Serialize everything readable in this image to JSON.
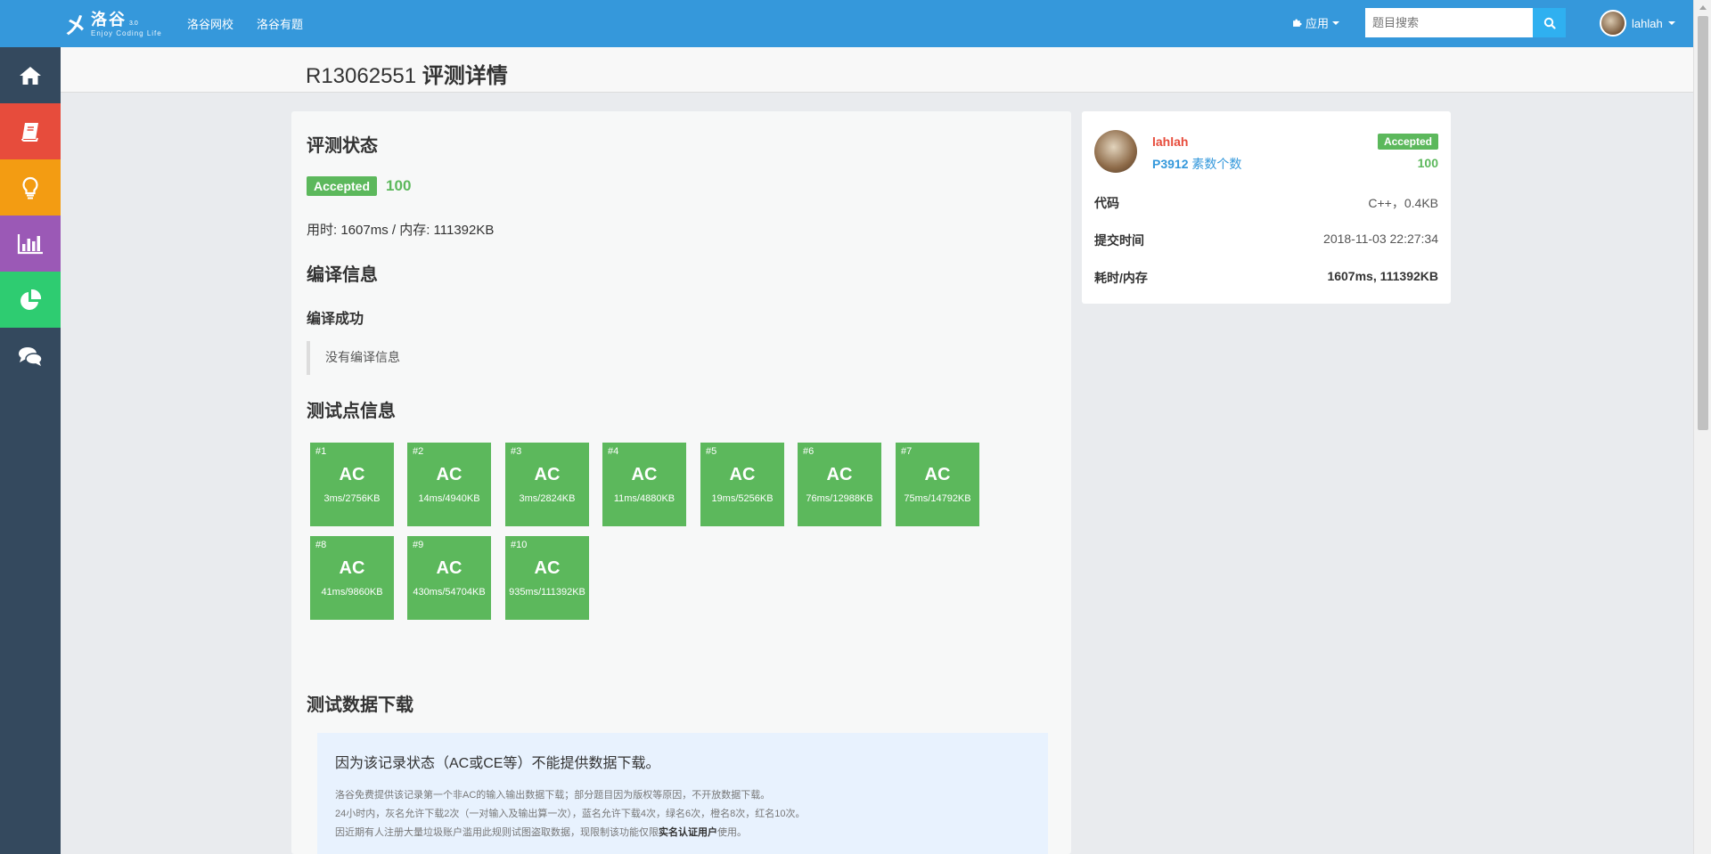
{
  "brand": {
    "logo_mark": "㐅",
    "logo_cn": "洛谷",
    "logo_version": "3.0",
    "logo_en": "Enjoy Coding Life"
  },
  "nav": {
    "links": [
      "洛谷网校",
      "洛谷有题"
    ],
    "apps_label": "应用",
    "search_placeholder": "题目搜索",
    "username": "lahlah"
  },
  "sidebar": {
    "items": [
      "home-icon",
      "book-icon",
      "bulb-icon",
      "chart-icon",
      "pie-icon",
      "chat-icon"
    ]
  },
  "page": {
    "record_id": "R13062551",
    "title_suffix": "评测详情"
  },
  "status": {
    "heading": "评测状态",
    "result": "Accepted",
    "score": "100",
    "usage": "用时: 1607ms / 内存: 111392KB"
  },
  "compile": {
    "heading": "编译信息",
    "result": "编译成功",
    "message": "没有编译信息"
  },
  "testcases": {
    "heading": "测试点信息",
    "items": [
      {
        "id": "#1",
        "result": "AC",
        "detail": "3ms/2756KB"
      },
      {
        "id": "#2",
        "result": "AC",
        "detail": "14ms/4940KB"
      },
      {
        "id": "#3",
        "result": "AC",
        "detail": "3ms/2824KB"
      },
      {
        "id": "#4",
        "result": "AC",
        "detail": "11ms/4880KB"
      },
      {
        "id": "#5",
        "result": "AC",
        "detail": "19ms/5256KB"
      },
      {
        "id": "#6",
        "result": "AC",
        "detail": "76ms/12988KB"
      },
      {
        "id": "#7",
        "result": "AC",
        "detail": "75ms/14792KB"
      },
      {
        "id": "#8",
        "result": "AC",
        "detail": "41ms/9860KB"
      },
      {
        "id": "#9",
        "result": "AC",
        "detail": "430ms/54704KB"
      },
      {
        "id": "#10",
        "result": "AC",
        "detail": "935ms/111392KB"
      }
    ]
  },
  "download": {
    "heading": "测试数据下载",
    "main": "因为该记录状态（AC或CE等）不能提供数据下载。",
    "note1": "洛谷免费提供该记录第一个非AC的输入输出数据下载；部分题目因为版权等原因，不开放数据下载。",
    "note2": "24小时内，灰名允许下载2次（一对输入及输出算一次），蓝名允许下载4次，绿名6次，橙名8次，红名10次。",
    "note3_pre": "因近期有人注册大量垃圾账户滥用此规则试图盗取数据，现限制该功能仅限",
    "note3_bold": "实名认证用户",
    "note3_post": "使用。"
  },
  "summary": {
    "username": "lahlah",
    "badge": "Accepted",
    "score": "100",
    "problem_id": "P3912",
    "problem_name": "素数个数",
    "rows": [
      {
        "key": "代码",
        "value": "C++，0.4KB"
      },
      {
        "key": "提交时间",
        "value": "2018-11-03 22:27:34"
      },
      {
        "key": "耗时/内存",
        "value": "1607ms, 111392KB"
      }
    ]
  },
  "colors": {
    "topbar": "#3598db",
    "accepted": "#5cb85c",
    "sidebar": "#34495e"
  }
}
